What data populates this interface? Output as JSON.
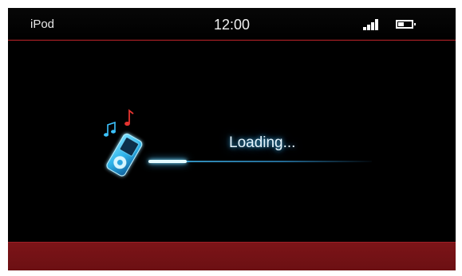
{
  "status_bar": {
    "app_title": "iPod",
    "time": "12:00",
    "signal_icon": "signal-bars-icon",
    "battery_icon": "battery-icon"
  },
  "main": {
    "device_icon": "ipod-nano-icon",
    "music_note_icons": [
      "music-note-icon",
      "music-note-icon"
    ],
    "loading_text": "Loading...",
    "progress_fraction": 0.17
  },
  "colors": {
    "accent_red": "#c0242b",
    "bottom_bar": "#7c1418",
    "glow_blue": "#39b6ff"
  }
}
